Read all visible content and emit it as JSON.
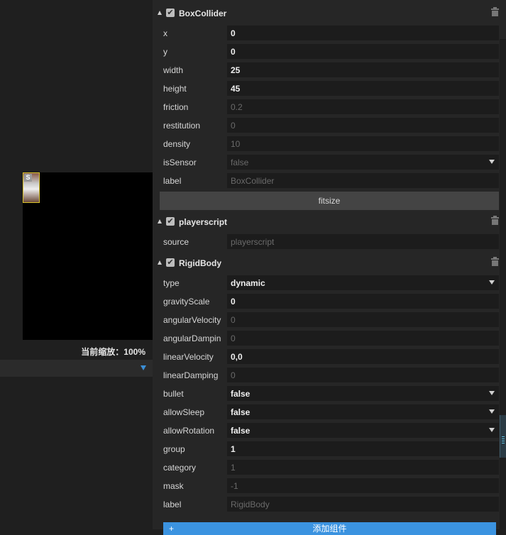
{
  "scene": {
    "sprite_badge": "S",
    "zoom_label": "当前缩放：100%"
  },
  "components": [
    {
      "name": "BoxCollider",
      "fields": [
        {
          "label": "x",
          "value": "0",
          "style": "b"
        },
        {
          "label": "y",
          "value": "0",
          "style": "b"
        },
        {
          "label": "width",
          "value": "25",
          "style": "b"
        },
        {
          "label": "height",
          "value": "45",
          "style": "b"
        },
        {
          "label": "friction",
          "value": "0.2",
          "style": "d"
        },
        {
          "label": "restitution",
          "value": "0",
          "style": "d"
        },
        {
          "label": "density",
          "value": "10",
          "style": "d"
        },
        {
          "label": "isSensor",
          "value": "false",
          "style": "d",
          "dropdown": true
        },
        {
          "label": "label",
          "value": "BoxCollider",
          "style": "d"
        }
      ],
      "button": "fitsize"
    },
    {
      "name": "playerscript",
      "fields": [
        {
          "label": "source",
          "value": "playerscript",
          "style": "d"
        }
      ]
    },
    {
      "name": "RigidBody",
      "fields": [
        {
          "label": "type",
          "value": "dynamic",
          "style": "b",
          "dropdown": true
        },
        {
          "label": "gravityScale",
          "value": "0",
          "style": "b"
        },
        {
          "label": "angularVelocity",
          "value": "0",
          "style": "d"
        },
        {
          "label": "angularDampin",
          "value": "0",
          "style": "d"
        },
        {
          "label": "linearVelocity",
          "value": "0,0",
          "style": "b"
        },
        {
          "label": "linearDamping",
          "value": "0",
          "style": "d"
        },
        {
          "label": "bullet",
          "value": "false",
          "style": "b",
          "dropdown": true
        },
        {
          "label": "allowSleep",
          "value": "false",
          "style": "b",
          "dropdown": true
        },
        {
          "label": "allowRotation",
          "value": "false",
          "style": "b",
          "dropdown": true
        },
        {
          "label": "group",
          "value": "1",
          "style": "b"
        },
        {
          "label": "category",
          "value": "1",
          "style": "d"
        },
        {
          "label": "mask",
          "value": "-1",
          "style": "d"
        },
        {
          "label": "label",
          "value": "RigidBody",
          "style": "d"
        }
      ]
    }
  ],
  "add_component": {
    "icon": "plus-icon",
    "label": "添加组件"
  },
  "colors": {
    "accent": "#3b93e0",
    "sprite_border": "#d9c22a"
  }
}
